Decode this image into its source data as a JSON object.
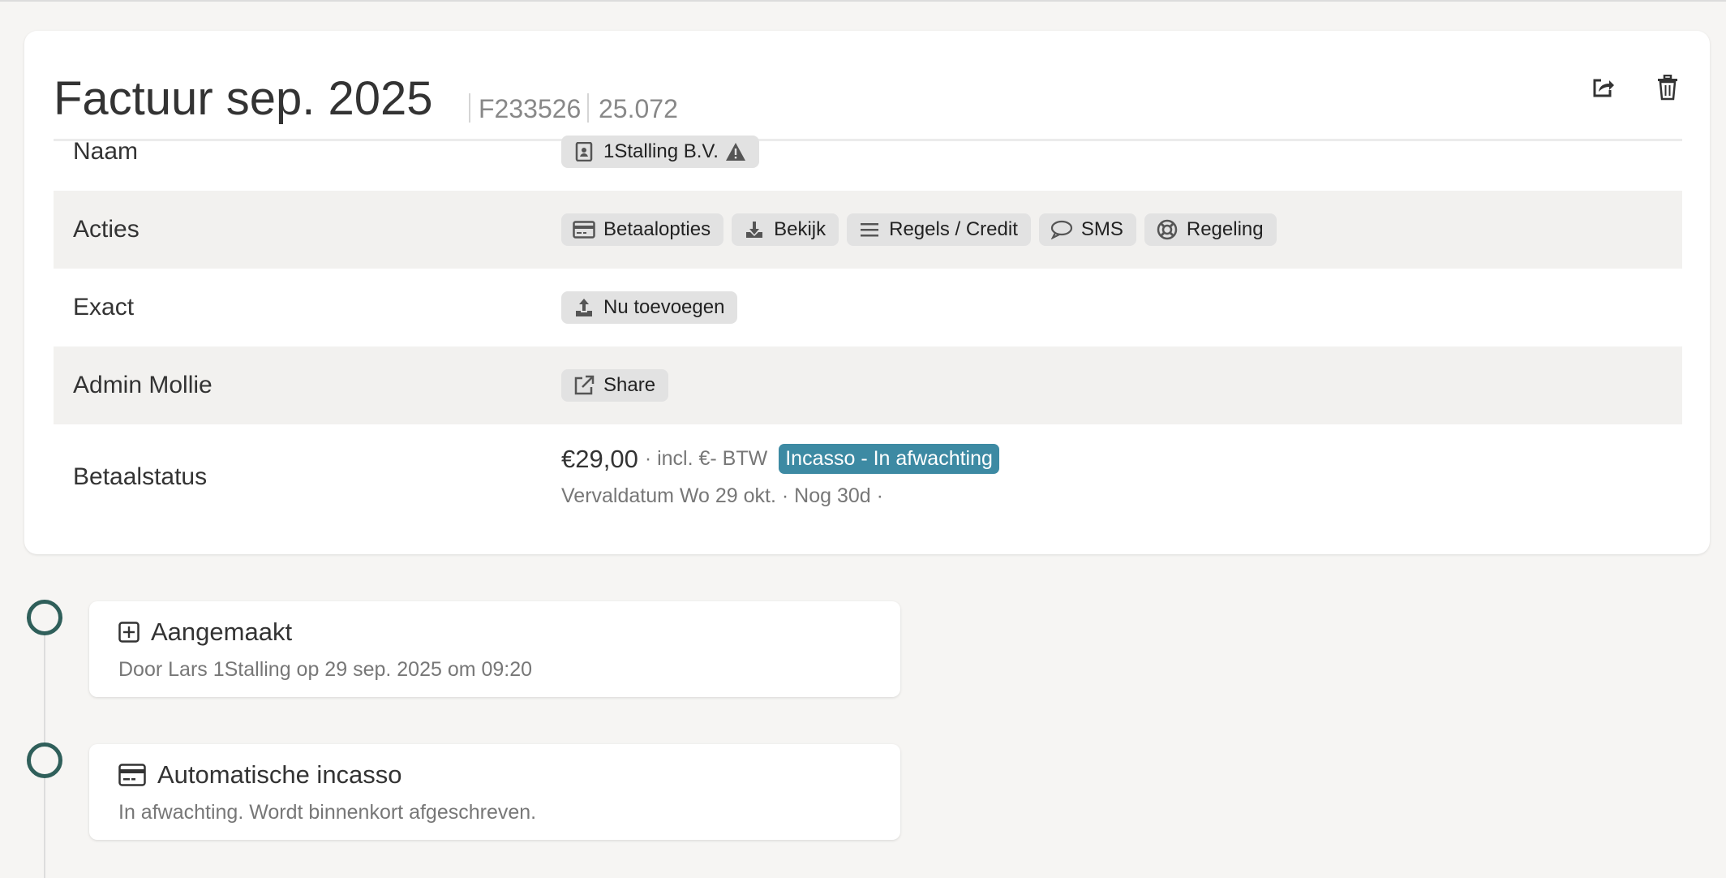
{
  "invoice": {
    "title": "Factuur sep. 2025",
    "number": "F233526",
    "customer_ref": "25.072"
  },
  "header_actions": {
    "share_icon": "share-icon",
    "delete_icon": "trash-icon"
  },
  "rows": {
    "naam": {
      "label": "Naam",
      "customer": "1Stalling B.V."
    },
    "acties": {
      "label": "Acties",
      "buttons": {
        "betaalopties": "Betaalopties",
        "bekijk": "Bekijk",
        "regels": "Regels / Credit",
        "sms": "SMS",
        "regeling": "Regeling"
      }
    },
    "exact": {
      "label": "Exact",
      "button": "Nu toevoegen"
    },
    "admin": {
      "label": "Admin Mollie",
      "button": "Share"
    },
    "betaalstatus": {
      "label": "Betaalstatus",
      "amount": "€29,00",
      "incl": "· incl. €- BTW",
      "badge": "Incasso - In afwachting",
      "due": "Vervaldatum Wo 29 okt. · Nog 30d ·"
    }
  },
  "timeline": [
    {
      "title": "Aangemaakt",
      "description": "Door Lars 1Stalling op 29 sep. 2025 om 09:20",
      "icon": "plus-square-icon"
    },
    {
      "title": "Automatische incasso",
      "description": "In afwachting. Wordt binnenkort afgeschreven.",
      "icon": "credit-card-icon"
    }
  ],
  "colors": {
    "badge": "#3d8aa3",
    "timeline_dot": "#2f5f5a",
    "page_background": "#f6f5f3"
  }
}
